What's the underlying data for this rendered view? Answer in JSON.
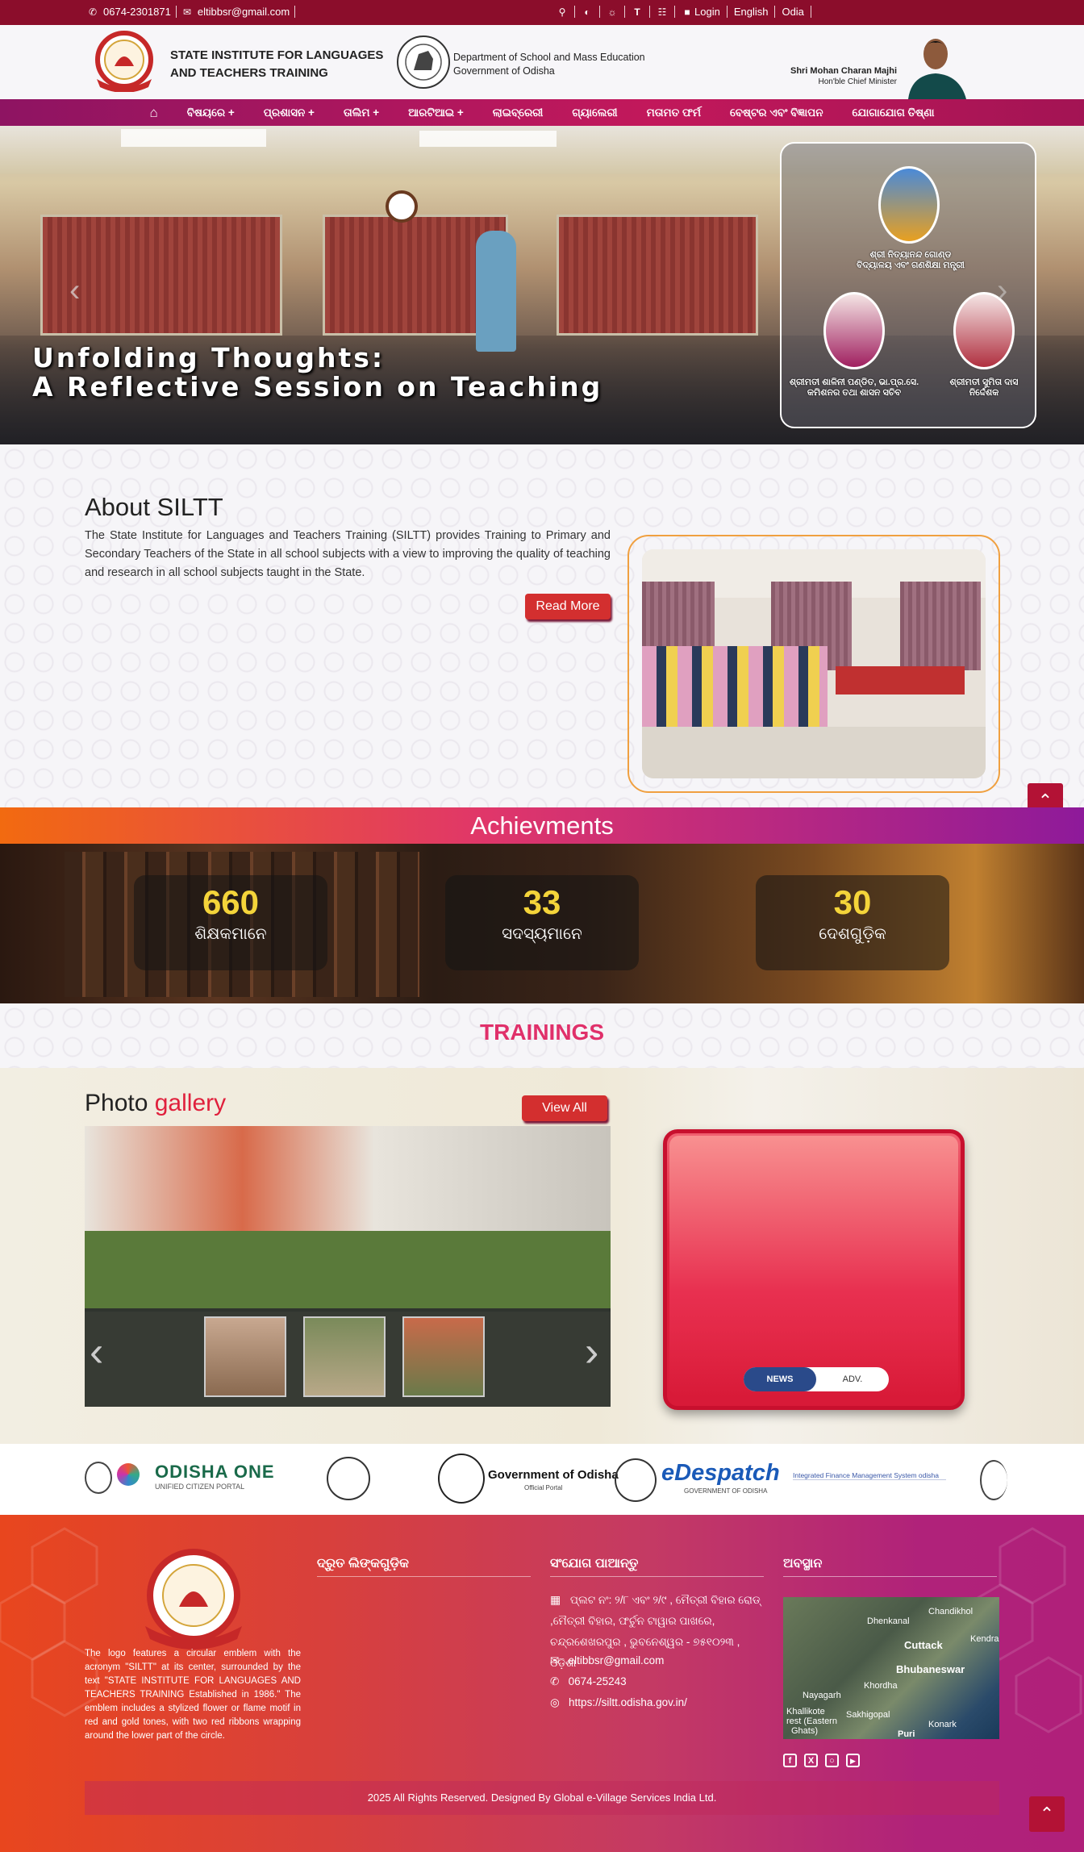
{
  "topbar": {
    "phone": "0674-2301871",
    "email": "eltibbsr@gmail.com",
    "login": "Login",
    "english": "English",
    "odia": "Odia"
  },
  "header": {
    "inst_line1": "STATE INSTITUTE FOR LANGUAGES",
    "inst_line2": "AND TEACHERS TRAINING",
    "dept_line1": "Department of School and Mass Education",
    "dept_line2": "Government of Odisha",
    "cm_name": "Shri Mohan Charan Majhi",
    "cm_title": "Hon'ble Chief Minister"
  },
  "nav": [
    "ବିଷୟରେ +",
    "ପ୍ରଶାସନ +",
    "ତାଲିମ +",
    "ଆରଟିଆଇ +",
    "ଲାଇବ୍ରେରୀ",
    "ଗ୍ୟାଲେରୀ",
    "ମତାମତ ଫର୍ମ",
    "ବେଷ୍ଟର ଏବଂ ବିଜ୍ଞାପନ",
    "ଯୋଗାଯୋଗ ତିଷ୍ଣା"
  ],
  "hero": {
    "title1": "Unfolding Thoughts:",
    "title2": "A Reflective Session on Teaching",
    "p1_line1": "ଶ୍ରୀ ନିତ୍ୟାନନ୍ଦ ଗୋଣ୍ଡ",
    "p1_line2": "ବିଦ୍ୟାଳୟ ଏବଂ ଗଣଶିକ୍ଷା ମନ୍ତ୍ରୀ",
    "p2_line1": "ଶ୍ରୀମତୀ ଶାଳିନୀ ପଣ୍ଡିତ, ଭା.ପ୍ର.ସେ.",
    "p2_line2": "କମିଶନର ତଥା ଶାସନ ସଚିବ",
    "p3_line1": "ଶ୍ରୀମତୀ ସୁମିତା ଦାସ",
    "p3_line2": "ନିର୍ଦ୍ଦେଶକ"
  },
  "about": {
    "title": "About SILTT",
    "text": "The State Institute for Languages and Teachers Training (SILTT) provides Training to Primary and Secondary Teachers of the State in all school subjects with a view to improving the quality of teaching and research in all school subjects taught in the State.",
    "read_more": "Read More"
  },
  "achievements": {
    "title": "Achievments",
    "stats": [
      {
        "num": "660",
        "label": "ଶିକ୍ଷକମାନେ"
      },
      {
        "num": "33",
        "label": "ସଦସ୍ୟମାନେ"
      },
      {
        "num": "30",
        "label": "ଦେଶଗୁଡ଼ିକ"
      }
    ]
  },
  "trainings": {
    "title": "TRAININGS"
  },
  "gallery": {
    "title_a": "Photo",
    "title_b": "gallery",
    "view_all": "View All",
    "tab_news": "NEWS",
    "tab_adv": "ADV."
  },
  "logos": {
    "odisha_one": "ODISHA ONE",
    "odisha_one_sub": "UNIFIED CITIZEN PORTAL",
    "goo": "Government of Odisha",
    "goo_sub": "Official Portal",
    "edespatch": "eDespatch",
    "edespatch_sub": "GOVERNMENT OF ODISHA",
    "ifms": "Integrated Finance Management System odisha"
  },
  "footer": {
    "logo_text": "The logo features a circular emblem with the acronym \"SILTT\" at its center, surrounded by the text \"STATE INSTITUTE FOR LANGUAGES AND TEACHERS TRAINING Established in 1986.\" The emblem includes a stylized flower or flame motif in red and gold tones, with two red ribbons wrapping around the lower part of the circle.",
    "quick_links": "ଦ୍ରୁତ ଲିଙ୍କଗୁଡ଼ିକ",
    "contact": "ସଂଯୋଗ ପାଆନ୍ତୁ",
    "address": "ପ୍ଲଟ ନଂ: ୨/୮ ଏବଂ ୨/୯ , ମୈତ୍ରୀ ବିହାର ରୋଡ୍ ,ମୈତ୍ରୀ ବିହାର, ଫର୍ଚୁନ ଟାୱାର ପାଖରେ, ଚନ୍ଦ୍ରଶେଖରପୁର , ଭୁବନେଶ୍ୱର - ୭୫୧୦୨୩ , ଓଡ଼ିଶା",
    "email": "eltibbsr@gmail.com",
    "phone": "0674-25243",
    "website": "https://siltt.odisha.gov.in/",
    "location": "ଅବସ୍ଥାନ",
    "map_labels": [
      "Chandikhol",
      "Dhenkanal",
      "Cuttack",
      "Kendra",
      "Bhubaneswar",
      "Khordha",
      "Nayagarh",
      "Khallikote",
      "rest (Eastern",
      "Ghats)",
      "Sakhigopal",
      "Konark",
      "Puri"
    ],
    "copyright": "2025 All Rights Reserved. Designed By Global e-Village Services India Ltd."
  },
  "colors": {
    "topbar": "#8b0d2b",
    "nav": "#c2185b",
    "accent": "#d32f2f",
    "gallery_red": "#e0203c",
    "stat_yellow": "#f4d43a"
  }
}
